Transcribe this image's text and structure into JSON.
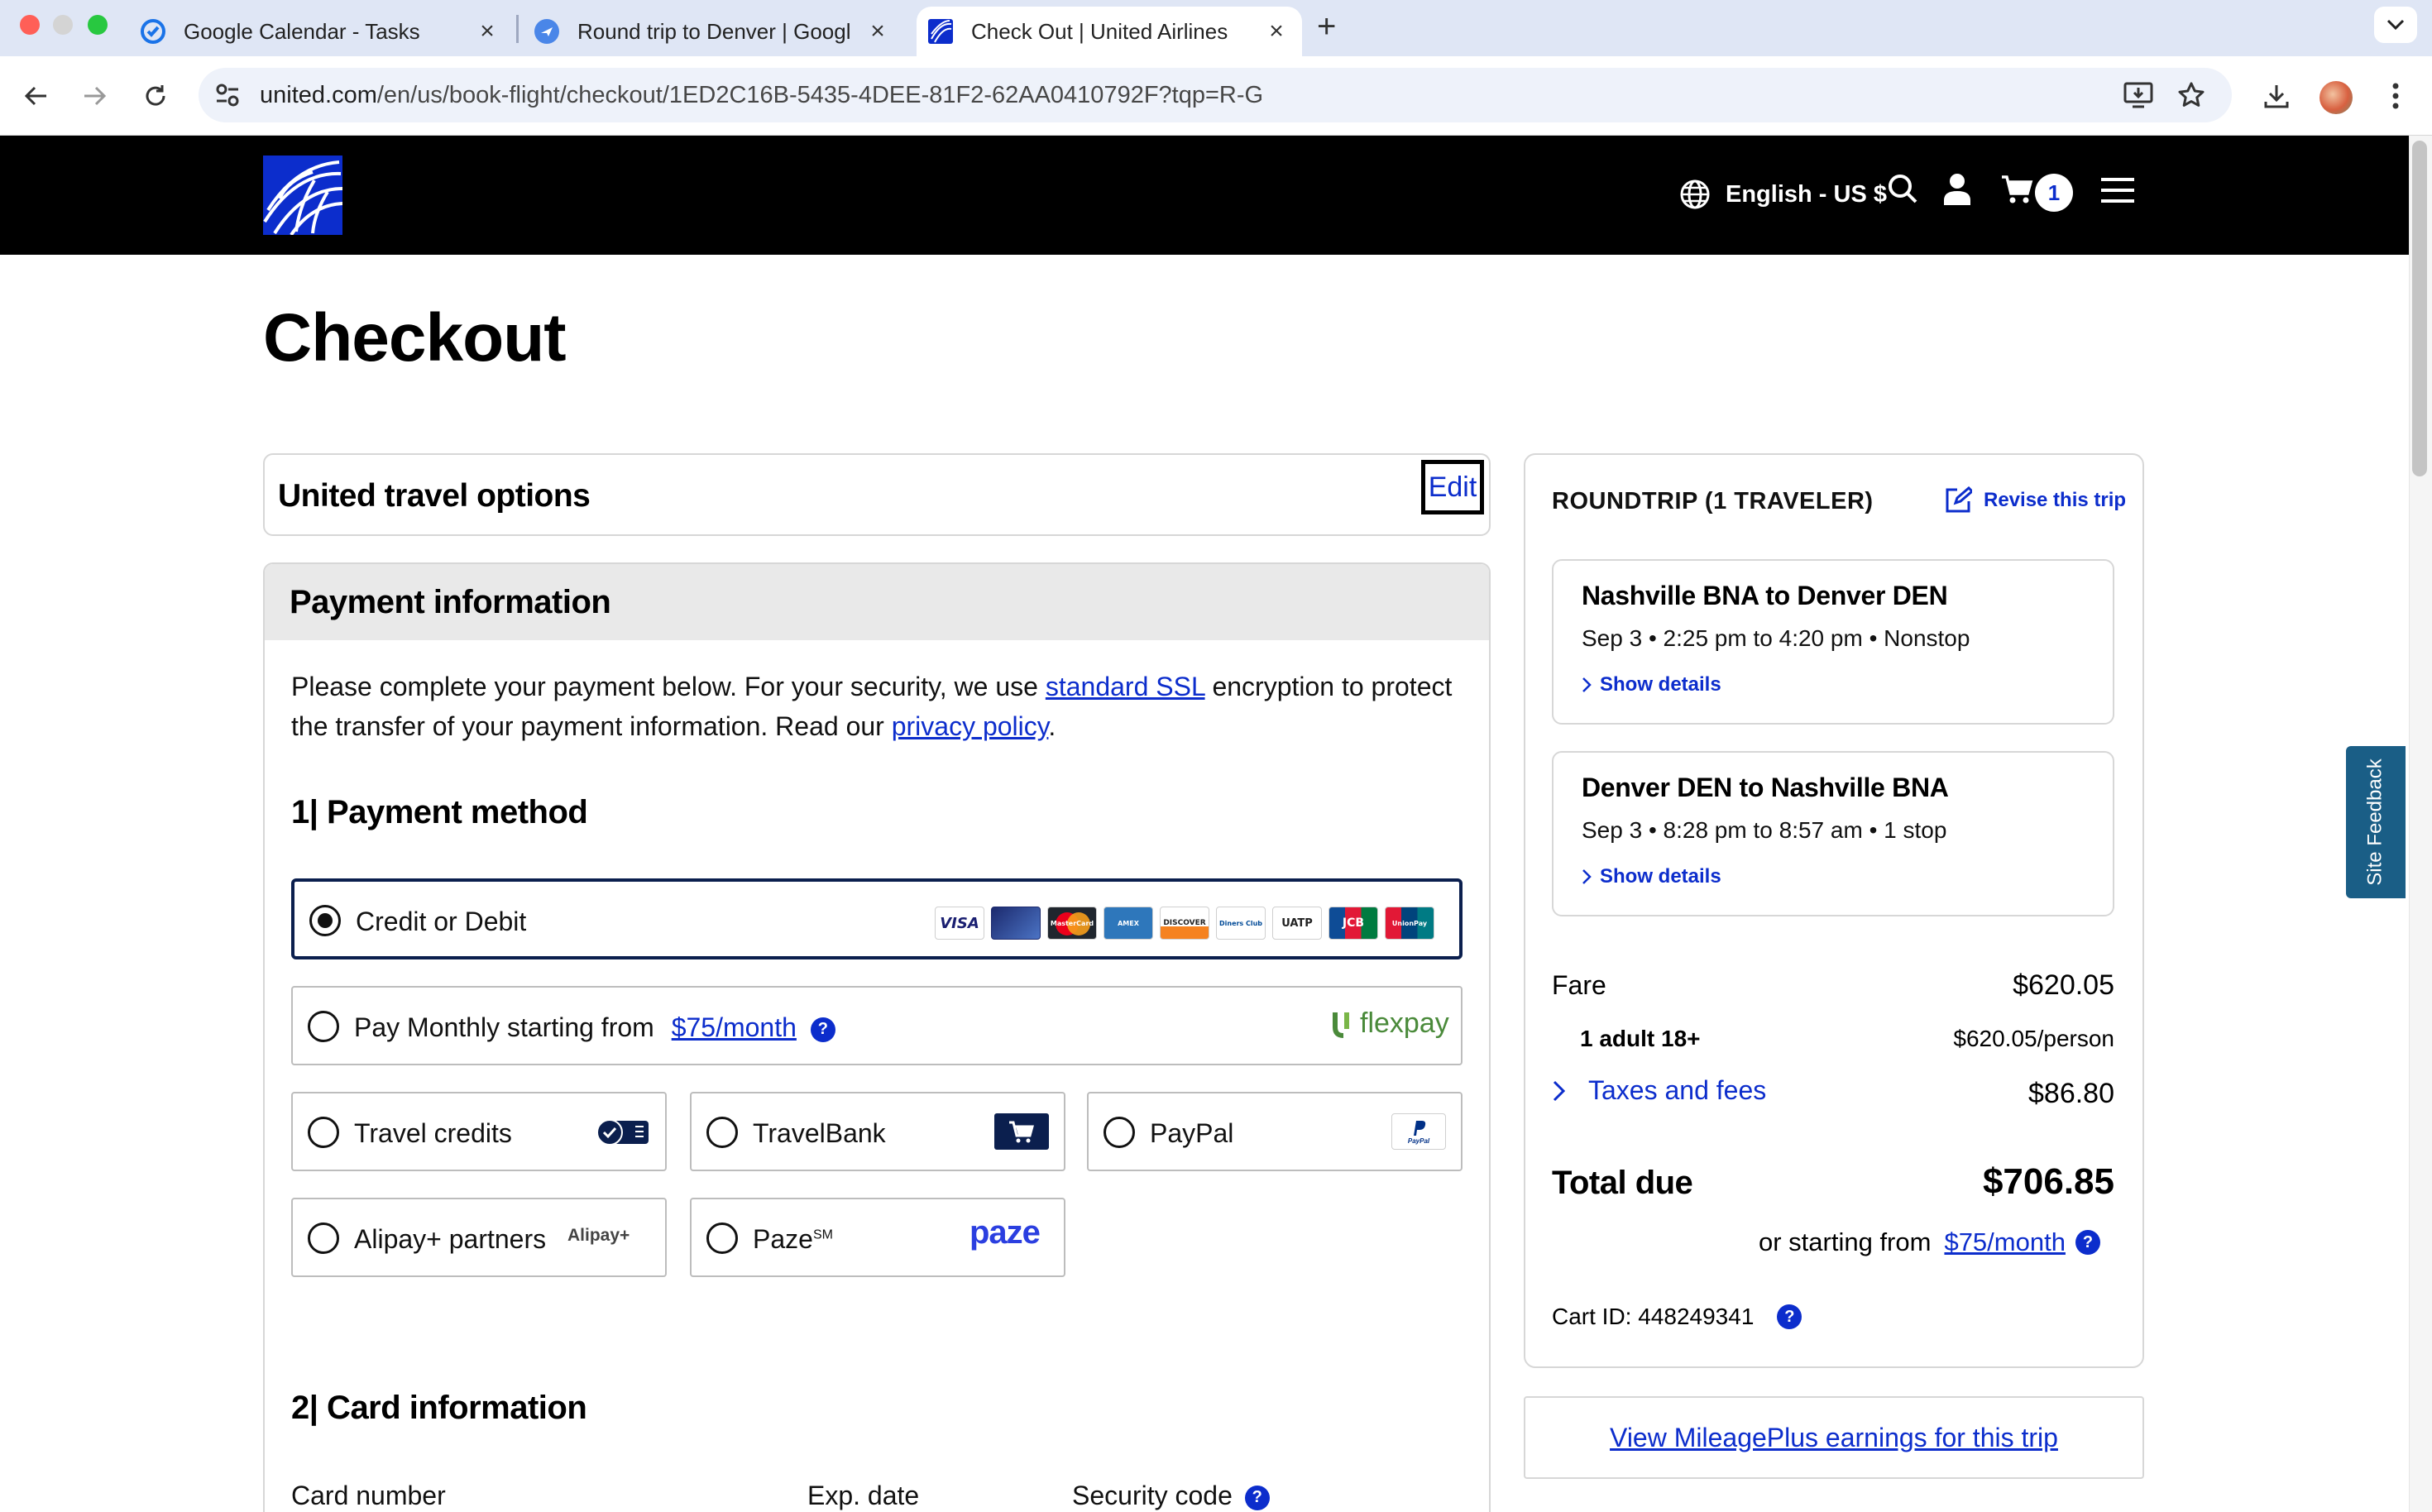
{
  "browser": {
    "tabs": [
      {
        "title": "Google Calendar - Tasks",
        "icon": "google-tasks-icon",
        "active": false
      },
      {
        "title": "Round trip to Denver | Google",
        "icon": "google-flights-icon",
        "active": false
      },
      {
        "title": "Check Out | United Airlines",
        "icon": "united-globe-icon",
        "active": true
      }
    ],
    "url_host": "united.com",
    "url_path": "/en/us/book-flight/checkout/1ED2C16B-5435-4DEE-81F2-62AA0410792F?tqp=R-G"
  },
  "header": {
    "language": "English - US $",
    "cart_count": "1"
  },
  "page": {
    "title": "Checkout",
    "travel_options_label": "United travel options",
    "edit_label": "Edit",
    "payment_info_label": "Payment information",
    "intro_part1": "Please complete your payment below. For your security, we use ",
    "intro_link1": "standard SSL",
    "intro_part2": " encryption to protect the transfer of your payment information. Read our ",
    "intro_link2": "privacy policy",
    "intro_part3": ".",
    "payment_method_title": "1| Payment method",
    "card_info_title": "2| Card information"
  },
  "payment_options": {
    "credit": {
      "label": "Credit or Debit",
      "selected": true
    },
    "monthly": {
      "label": "Pay Monthly starting from",
      "link": "$75/month",
      "brand": "flexpay"
    },
    "travel_credits": {
      "label": "Travel credits"
    },
    "travelbank": {
      "label": "TravelBank"
    },
    "paypal": {
      "label": "PayPal",
      "brand": "PayPal"
    },
    "alipay": {
      "label": "Alipay+ partners",
      "brand": "Alipay+"
    },
    "paze": {
      "label": "Paze",
      "sup": "SM",
      "brand": "paze"
    }
  },
  "card_brands": [
    "VISA",
    "",
    "MasterCard",
    "AMEX",
    "DISCOVER",
    "Diners Club",
    "UATP",
    "JCB",
    "UnionPay"
  ],
  "card_fields": {
    "number_label": "Card number",
    "exp_label": "Exp. date",
    "security_label": "Security code"
  },
  "summary": {
    "title": "ROUNDTRIP (1 TRAVELER)",
    "revise_label": "Revise this trip",
    "legs": [
      {
        "route": "Nashville BNA to Denver DEN",
        "when": "Sep 3 • 2:25 pm to 4:20 pm • Nonstop",
        "details": "Show details"
      },
      {
        "route": "Denver DEN to Nashville BNA",
        "when": "Sep 3 • 8:28 pm to 8:57 am • 1 stop",
        "details": "Show details"
      }
    ],
    "fare_label": "Fare",
    "fare_value": "$620.05",
    "adult_label": "1 adult 18+",
    "adult_value": "$620.05/person",
    "taxes_label": "Taxes and fees",
    "taxes_value": "$86.80",
    "total_label": "Total due",
    "total_value": "$706.85",
    "starting_label": "or starting from",
    "starting_link": "$75/month",
    "cart_id": "Cart ID: 448249341",
    "mileage_link": "View MileagePlus earnings for this trip"
  },
  "feedback_label": "Site Feedback",
  "colors": {
    "united_blue": "#0c2dcc",
    "selected_border": "#0b1f4e",
    "header_bg": "#000000",
    "feedback_bg": "#1a5e86"
  }
}
